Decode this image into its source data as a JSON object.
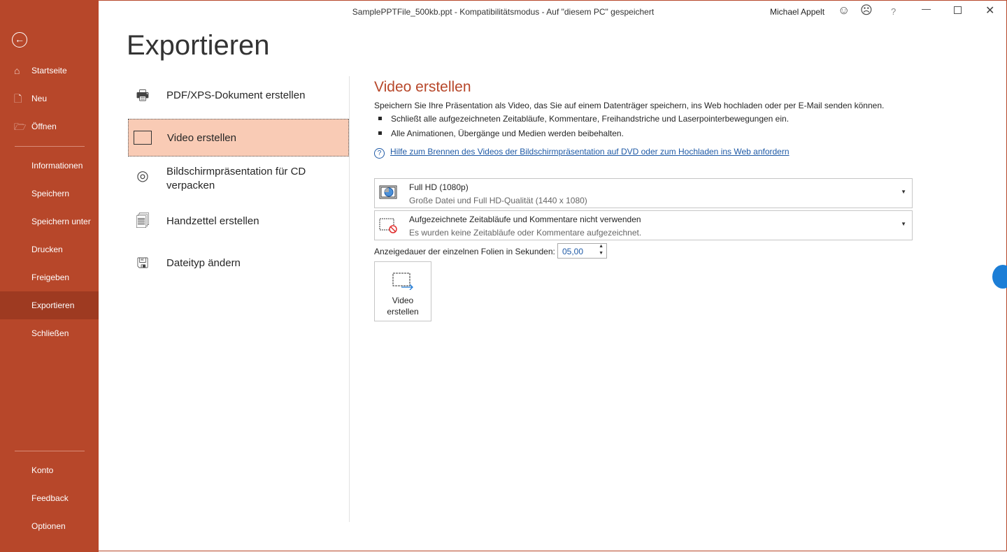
{
  "window": {
    "title": "SamplePPTFile_500kb.ppt  -  Kompatibilitätsmodus  -  Auf \"diesem PC\" gespeichert",
    "user": "Michael Appelt",
    "help": "?"
  },
  "sidebar": {
    "items": [
      {
        "label": "Startseite",
        "icon": "home-icon"
      },
      {
        "label": "Neu",
        "icon": "new-file-icon"
      },
      {
        "label": "Öffnen",
        "icon": "folder-icon"
      },
      {
        "label": "Informationen"
      },
      {
        "label": "Speichern"
      },
      {
        "label": "Speichern unter"
      },
      {
        "label": "Drucken"
      },
      {
        "label": "Freigeben"
      },
      {
        "label": "Exportieren",
        "selected": true
      },
      {
        "label": "Schließen"
      },
      {
        "label": "Konto"
      },
      {
        "label": "Feedback"
      },
      {
        "label": "Optionen"
      }
    ]
  },
  "page_title": "Exportieren",
  "export_options": [
    {
      "label": "PDF/XPS-Dokument erstellen"
    },
    {
      "label": "Video erstellen"
    },
    {
      "label": "Bildschirmpräsentation für CD verpacken"
    },
    {
      "label": "Handzettel erstellen"
    },
    {
      "label": "Dateityp ändern"
    }
  ],
  "detail": {
    "title": "Video erstellen",
    "description": "Speichern Sie Ihre Präsentation als Video, das Sie auf einem Datenträger speichern, ins Web hochladen oder per E-Mail senden können.",
    "bullets": [
      "Schließt alle aufgezeichneten Zeitabläufe, Kommentare, Freihandstriche und Laserpointerbewegungen ein.",
      "Alle Animationen, Übergänge und Medien werden beibehalten."
    ],
    "help_link": "Hilfe zum Brennen des Videos der Bildschirmpräsentation auf DVD oder zum Hochladen ins Web anfordern",
    "quality": {
      "title": "Full HD (1080p)",
      "subtitle": "Große Datei und Full HD-Qualität (1440 x 1080)"
    },
    "timings": {
      "title": "Aufgezeichnete Zeitabläufe und Kommentare nicht verwenden",
      "subtitle": "Es wurden keine Zeitabläufe oder Kommentare aufgezeichnet."
    },
    "duration_label": "Anzeigedauer der einzelnen Folien in Sekunden:",
    "duration_value": "05,00",
    "create_button": "Video erstellen"
  },
  "colors": {
    "accent": "#b7472a",
    "selected": "#f9cbb5",
    "link": "#1f5aa6"
  }
}
